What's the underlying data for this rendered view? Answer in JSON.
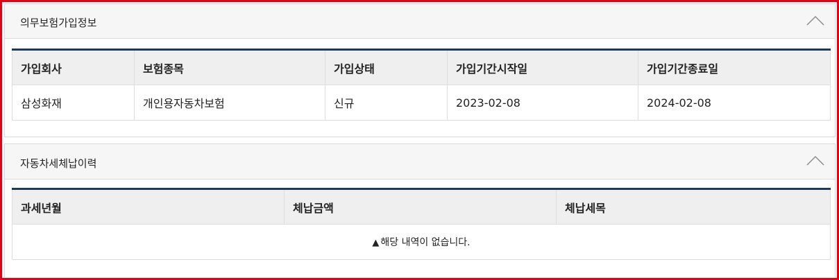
{
  "insurance": {
    "title": "의무보험가입정보",
    "headers": [
      "가입회사",
      "보험종목",
      "가입상태",
      "가입기간시작일",
      "가입기간종료일"
    ],
    "rows": [
      [
        "삼성화재",
        "개인용자동차보험",
        "신규",
        "2023-02-08",
        "2024-02-08"
      ]
    ]
  },
  "tax": {
    "title": "자동차세체납이력",
    "headers": [
      "과세년월",
      "체납금액",
      "체납세목"
    ],
    "empty_message": "해당 내역이 없습니다.",
    "empty_icon": "warning-icon"
  },
  "colors": {
    "frame_border": "#e60012",
    "table_top_border": "#1b3a5c",
    "header_bg": "#efefef",
    "panel_head_bg": "#f6f6f6"
  }
}
